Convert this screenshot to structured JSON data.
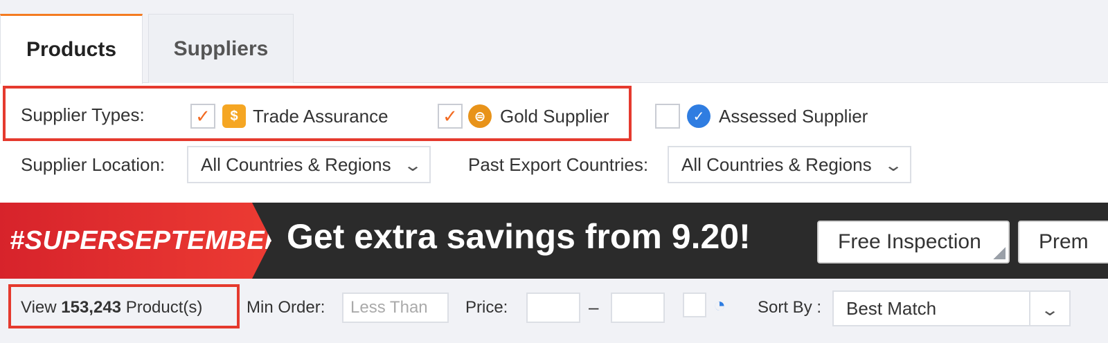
{
  "tabs": [
    {
      "label": "Products",
      "active": true
    },
    {
      "label": "Suppliers",
      "active": false
    }
  ],
  "filters": {
    "supplier_types_label": "Supplier Types:",
    "types": [
      {
        "label": "Trade Assurance",
        "checked": true,
        "icon": "shield-dollar-icon",
        "checkmark": "✓",
        "glyph": "$"
      },
      {
        "label": "Gold Supplier",
        "checked": true,
        "icon": "gold-coin-icon",
        "checkmark": "✓",
        "glyph": "⊜"
      },
      {
        "label": "Assessed Supplier",
        "checked": false,
        "icon": "verified-badge-icon",
        "glyph": "✓"
      }
    ],
    "location_label": "Supplier Location:",
    "location_value": "All Countries & Regions",
    "export_label": "Past Export Countries:",
    "export_value": "All Countries & Regions",
    "chevron": "⌄"
  },
  "banner": {
    "hashtag": "#SUPERSEPTEMBER",
    "headline": "Get extra savings from 9.20!",
    "buttons": [
      "Free Inspection",
      "Prem"
    ]
  },
  "results": {
    "view_prefix": "View ",
    "count": "153,243",
    "view_suffix": " Product(s)",
    "min_order_label": "Min Order:",
    "min_order_placeholder": "Less Than",
    "price_label": "Price:",
    "price_sep": "–",
    "sort_label": "Sort By :",
    "sort_value": "Best Match",
    "chevron": "⌄",
    "face_glyph": "◔"
  },
  "colors": {
    "accent": "#f47b20",
    "highlight": "#e53a2e",
    "banner_dark": "#2b2b2b",
    "banner_red": "#e3312f"
  }
}
